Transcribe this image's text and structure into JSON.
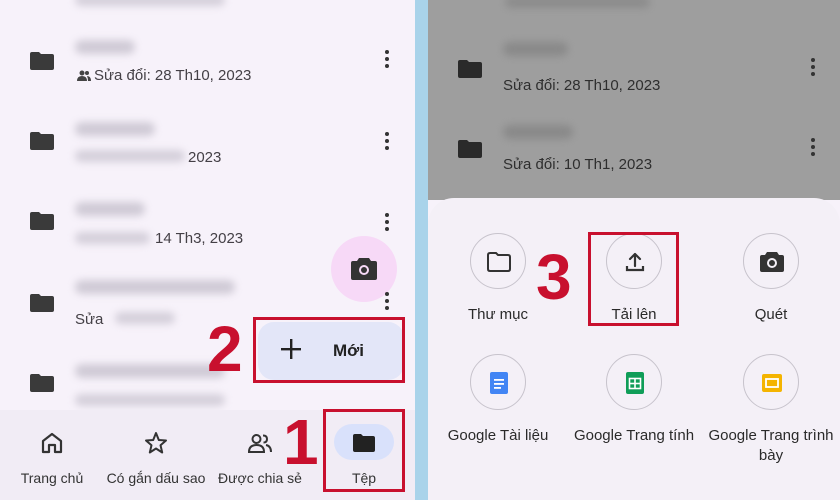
{
  "left_panel": {
    "files": [
      {
        "meta": "Sửa đổi: 28 Th10, 2023",
        "shared": true
      },
      {
        "meta": "2023",
        "shared": false
      },
      {
        "meta": "14 Th3, 2023",
        "shared": false
      },
      {
        "meta": "Sửa",
        "shared": false
      },
      {
        "meta": "",
        "shared": false
      }
    ],
    "new_button_label": "Mới",
    "bottom_nav": [
      {
        "label": "Trang chủ",
        "icon": "home-icon"
      },
      {
        "label": "Có gắn dấu sao",
        "icon": "star-icon"
      },
      {
        "label": "Được chia sẻ",
        "icon": "people-icon"
      },
      {
        "label": "Tệp",
        "icon": "folder-icon",
        "active": true
      }
    ]
  },
  "right_panel": {
    "files": [
      {
        "meta": "Sửa đổi: 28 Th10, 2023"
      },
      {
        "meta": "Sửa đổi: 10 Th1, 2023"
      }
    ],
    "create_options": [
      {
        "label": "Thư mục",
        "icon": "folder-outline-icon"
      },
      {
        "label": "Tải lên",
        "icon": "upload-icon"
      },
      {
        "label": "Quét",
        "icon": "camera-icon"
      },
      {
        "label": "Google Tài liệu",
        "icon": "docs-icon"
      },
      {
        "label": "Google Trang tính",
        "icon": "sheets-icon"
      },
      {
        "label": "Google Trang trình bày",
        "icon": "slides-icon"
      }
    ]
  },
  "step_markers": {
    "step1": "1",
    "step2": "2",
    "step3": "3"
  },
  "colors": {
    "accent_red": "#c8102e",
    "nav_pill": "#d9e1fb",
    "fab_pink": "#f7d9f7",
    "docs_blue": "#4285f4",
    "sheets_green": "#0f9d58",
    "slides_yellow": "#f4b400"
  }
}
